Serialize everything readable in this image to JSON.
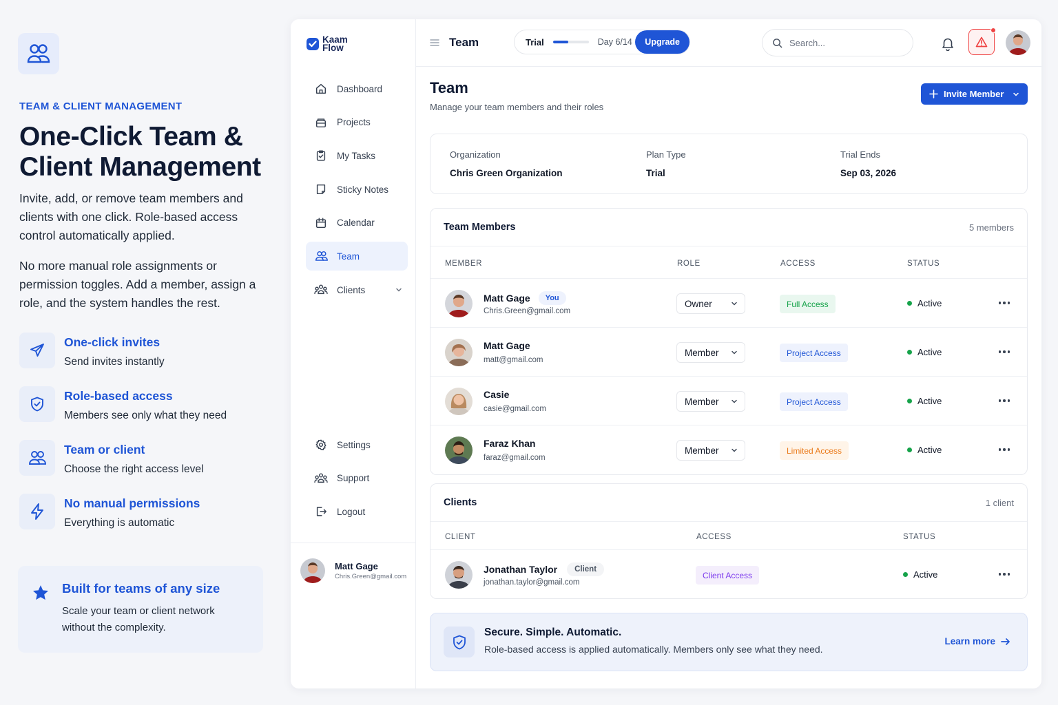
{
  "promo": {
    "eyebrow": "TEAM & CLIENT MANAGEMENT",
    "title": "One-Click Team & Client Management",
    "paragraph1": "Invite, add, or remove team members and clients with one click. Role-based access control automatically applied.",
    "paragraph2": "No more manual role assignments or permission toggles. Add a member, assign a role, and the system handles the rest.",
    "features": [
      {
        "icon": "send-icon",
        "title": "One-click invites",
        "desc": "Send invites instantly"
      },
      {
        "icon": "shield-check-icon",
        "title": "Role-based access",
        "desc": "Members see only what they need"
      },
      {
        "icon": "users-icon",
        "title": "Team or client",
        "desc": "Choose the right access level"
      },
      {
        "icon": "lightning-icon",
        "title": "No manual permissions",
        "desc": "Everything is automatic"
      }
    ],
    "built": {
      "icon": "star-icon",
      "title": "Built for teams of any size",
      "desc": "Scale your team or client network without the complexity."
    }
  },
  "brand": {
    "name_line1": "Kaam",
    "name_line2": "Flow",
    "accent": "#1f55d6"
  },
  "sidebar": {
    "items": [
      {
        "label": "Dashboard",
        "icon": "home-icon"
      },
      {
        "label": "Projects",
        "icon": "folder-icon"
      },
      {
        "label": "My Tasks",
        "icon": "clipboard-check-icon"
      },
      {
        "label": "Sticky Notes",
        "icon": "note-icon"
      },
      {
        "label": "Calendar",
        "icon": "calendar-icon"
      },
      {
        "label": "Team",
        "icon": "users-icon",
        "active": true
      },
      {
        "label": "Clients",
        "icon": "clients-icon",
        "expandable": true
      }
    ],
    "bottom_items": [
      {
        "label": "Settings",
        "icon": "gear-icon"
      },
      {
        "label": "Support",
        "icon": "support-icon"
      },
      {
        "label": "Logout",
        "icon": "logout-icon"
      }
    ],
    "user": {
      "name": "Matt Gage",
      "email": "Chris.Green@gmail.com"
    }
  },
  "topbar": {
    "title": "Team",
    "trial_label": "Trial",
    "trial_progress": 0.43,
    "trial_day": "Day 6/14",
    "upgrade_label": "Upgrade",
    "search_placeholder": "Search..."
  },
  "page": {
    "title": "Team",
    "subtitle": "Manage your team members and their roles",
    "invite_label": "Invite Member"
  },
  "organization": {
    "org_label": "Organization",
    "org_value": "Chris Green Organization",
    "plan_label": "Plan Type",
    "plan_value": "Trial",
    "ends_label": "Trial Ends",
    "ends_value": "Sep 03, 2026"
  },
  "team_members": {
    "title": "Team Members",
    "count": "5 members",
    "columns": [
      "MEMBER",
      "ROLE",
      "ACCESS",
      "STATUS"
    ],
    "rows": [
      {
        "name": "Matt Gage",
        "badge": "You",
        "email": "Chris.Green@gmail.com",
        "role": "Owner",
        "access": "Full Access",
        "access_type": "full",
        "status": "Active"
      },
      {
        "name": "Matt Gage",
        "badge": "",
        "email": "matt@gmail.com",
        "role": "Member",
        "access": "Project Access",
        "access_type": "project",
        "status": "Active"
      },
      {
        "name": "Casie",
        "badge": "",
        "email": "casie@gmail.com",
        "role": "Member",
        "access": "Project Access",
        "access_type": "project",
        "status": "Active"
      },
      {
        "name": "Faraz Khan",
        "badge": "",
        "email": "faraz@gmail.com",
        "role": "Member",
        "access": "Limited Access",
        "access_type": "limited",
        "status": "Active"
      }
    ]
  },
  "clients": {
    "title": "Clients",
    "count": "1 client",
    "columns": [
      "CLIENT",
      "ACCESS",
      "STATUS"
    ],
    "rows": [
      {
        "name": "Jonathan Taylor",
        "badge": "Client",
        "email": "jonathan.taylor@gmail.com",
        "access": "Client Access",
        "status": "Active"
      }
    ]
  },
  "banner": {
    "title": "Secure. Simple. Automatic.",
    "desc": "Role-based access is applied automatically. Members only see what they need.",
    "link": "Learn more"
  }
}
